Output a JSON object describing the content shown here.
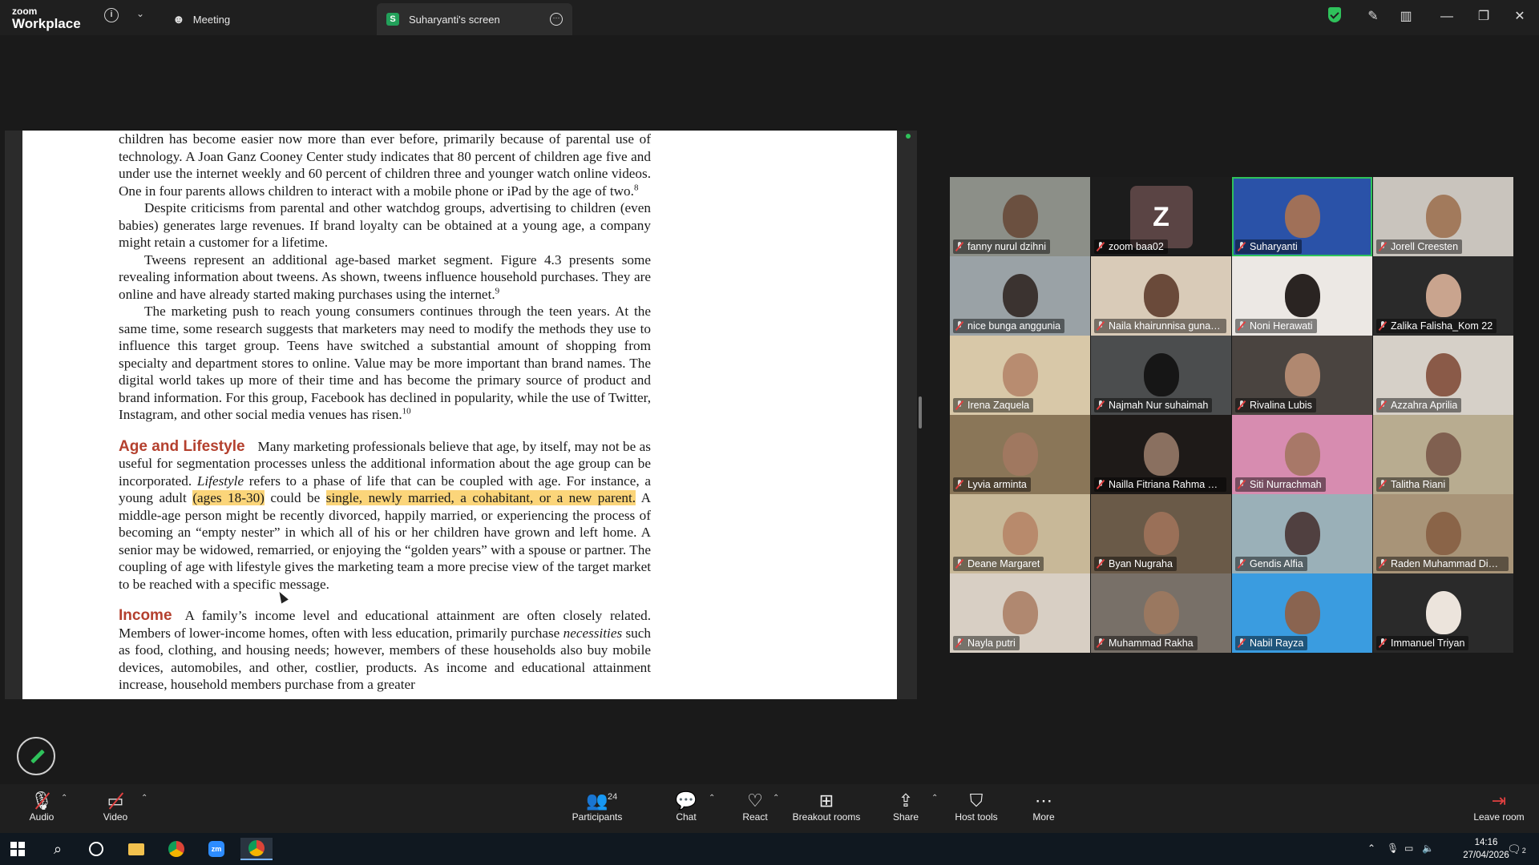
{
  "app": {
    "brand_small": "zoom",
    "brand_big": "Workplace"
  },
  "tabs": [
    {
      "label": "Meeting"
    },
    {
      "label": "Suharyanti's screen",
      "badge": "S"
    }
  ],
  "document": {
    "p1": "children has become easier now more than ever before, primarily because of parental use of technology. A Joan Ganz Cooney Center study indicates that 80 percent of children age five and under use the internet weekly and 60 percent of children three and younger watch online videos. One in four parents allows children to interact with a mobile phone or iPad by the age of two.",
    "p1_note": "8",
    "p2": "Despite criticisms from parental and other watchdog groups, advertising to children (even babies) generates large revenues. If brand loyalty can be obtained at a young age, a company might retain a customer for a lifetime.",
    "p3": "Tweens represent an additional age-based market segment. Figure 4.3 presents some revealing information about tweens. As shown, tweens influence household purchases. They are online and have already started making purchases using the internet.",
    "p3_note": "9",
    "p4": "The marketing push to reach young consumers continues through the teen years. At the same time, some research suggests that marketers may need to modify the methods they use to influence this target group. Teens have switched a substantial amount of shopping from specialty and department stores to online. Value may be more important than brand names. The digital world takes up more of their time and has become the primary source of product and brand information. For this group, Facebook has declined in popularity, while the use of Twitter, Instagram, and other social media venues has risen.",
    "p4_note": "10",
    "age_heading": "Age and Lifestyle",
    "age_1": "Many marketing professionals believe that age, by itself, may not be as useful for segmentation processes unless the additional information about the age group can be incorporated. ",
    "age_2_italic": "Lifestyle",
    "age_3": " refers to a phase of life that can be coupled with age. For instance, a young adult ",
    "age_hl1": "(ages 18-30)",
    "age_4": " could be ",
    "age_hl2": "single, newly married, a cohabitant, or a new parent.",
    "age_5": " A middle-age person might be recently divorced, happily married, or experiencing the process of becoming an “empty nester” in which all of his or her children have grown and left home. A senior may be widowed, remarried, or enjoying the “golden years” with a spouse or partner. The coupling of age with lifestyle gives the marketing team a more precise view of the target market to be reached with a specific message.",
    "income_heading": "Income",
    "inc_1": "A family’s income level and educational attainment are often closely related. Members of lower-income homes, often with less education, primarily purchase ",
    "inc_2_italic": "necessities",
    "inc_3": " such as food, clothing, and housing needs; however, members of these households also buy mobile devices, automobiles, and other, costlier, products. As income and educational attainment increase, household members purchase from a greater"
  },
  "participants": [
    {
      "name": "fanny nurul dzihni",
      "bg": "#8c8f88",
      "face": "#6b5040"
    },
    {
      "name": "zoom baa02",
      "bg": "#1c1c1c",
      "avatar": "Z"
    },
    {
      "name": "Suharyanti",
      "bg": "#2a52a8",
      "face": "#a07058"
    },
    {
      "name": "Jorell Creesten",
      "bg": "#c9c4bd",
      "face": "#a27a5c"
    },
    {
      "name": "nice bunga anggunia",
      "bg": "#9aa2a6",
      "face": "#3b3330"
    },
    {
      "name": "Naila khairunnisa gunaw...",
      "bg": "#d9cbb8",
      "face": "#6a4a3a"
    },
    {
      "name": "Noni Herawati",
      "bg": "#ece8e4",
      "face": "#2a2422"
    },
    {
      "name": "Zalika Falisha_Kom 22",
      "bg": "#2a2a2a",
      "face": "#c9a48e"
    },
    {
      "name": "Irena Zaquela",
      "bg": "#d8c8a8",
      "face": "#b88c70"
    },
    {
      "name": "Najmah Nur suhaimah",
      "bg": "#4b4d4e",
      "face": "#161616"
    },
    {
      "name": "Rivalina Lubis",
      "bg": "#4a4440",
      "face": "#b08870"
    },
    {
      "name": "Azzahra Aprilia",
      "bg": "#d6d0c8",
      "face": "#8a5a48"
    },
    {
      "name": "Lyvia arminta",
      "bg": "#8a7658",
      "face": "#a07860"
    },
    {
      "name": "Nailla Fitriana Rahma D...",
      "bg": "#1e1a18",
      "face": "#8a7060"
    },
    {
      "name": "Siti Nurrachmah",
      "bg": "#d78cb0",
      "face": "#a87868"
    },
    {
      "name": "Talitha Riani",
      "bg": "#b8ac90",
      "face": "#806050"
    },
    {
      "name": "Deane Margaret",
      "bg": "#c8b898",
      "face": "#b88a6c"
    },
    {
      "name": "Byan Nugraha",
      "bg": "#6a5a48",
      "face": "#9a7058"
    },
    {
      "name": "Gendis Alfia",
      "bg": "#9ab0b8",
      "face": "#504040"
    },
    {
      "name": "Raden Muhammad Dim...",
      "bg": "#a89478",
      "face": "#8a6448"
    },
    {
      "name": "Nayla putri",
      "bg": "#d8cfc4",
      "face": "#b08870"
    },
    {
      "name": "Muhammad Rakha",
      "bg": "#787068",
      "face": "#9a7860"
    },
    {
      "name": "Nabil Rayza",
      "bg": "#3a9ce0",
      "face": "#8a6450"
    },
    {
      "name": "Immanuel Triyan",
      "bg": "#2a2a2a",
      "face": "#ece4dc"
    }
  ],
  "toolbar": {
    "audio": "Audio",
    "video": "Video",
    "participants": "Participants",
    "participants_count": "24",
    "chat": "Chat",
    "react": "React",
    "breakout": "Breakout rooms",
    "share": "Share",
    "host_tools": "Host tools",
    "more": "More",
    "leave": "Leave room"
  },
  "taskbar": {
    "time": "14:16",
    "date": "27/04/2026",
    "notifications": "2"
  },
  "colors": {
    "accent_green": "#2fc25b",
    "highlight": "#fbd57a",
    "heading_red": "#b4402e",
    "muted_red": "#e04040"
  }
}
